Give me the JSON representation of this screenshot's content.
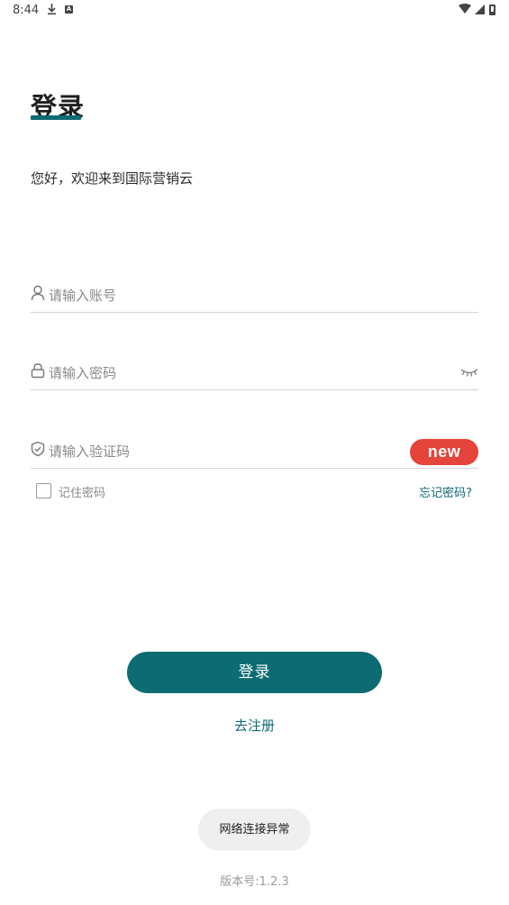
{
  "status_bar": {
    "time": "8:44",
    "download_icon": "download-icon",
    "notification_icon": "a-notification-icon",
    "wifi_icon": "wifi-icon",
    "signal_icon": "signal-icon",
    "battery_icon": "battery-icon"
  },
  "header": {
    "title": "登录",
    "welcome": "您好，欢迎来到国际营销云"
  },
  "form": {
    "account": {
      "placeholder": "请输入账号",
      "icon": "user-icon"
    },
    "password": {
      "placeholder": "请输入密码",
      "icon": "lock-icon",
      "toggle_icon": "eye-closed-icon"
    },
    "captcha": {
      "placeholder": "请输入验证码",
      "icon": "shield-check-icon",
      "captcha_text": "new"
    },
    "remember_label": "记住密码",
    "remember_checked": false,
    "forgot_label": "忘记密码?"
  },
  "actions": {
    "login_label": "登录",
    "register_label": "去注册"
  },
  "toast": "网络连接异常",
  "version": "版本号:1.2.3",
  "colors": {
    "accent": "#0d6b73",
    "captcha_bg": "#e4443a",
    "toast_bg": "#efefef"
  }
}
